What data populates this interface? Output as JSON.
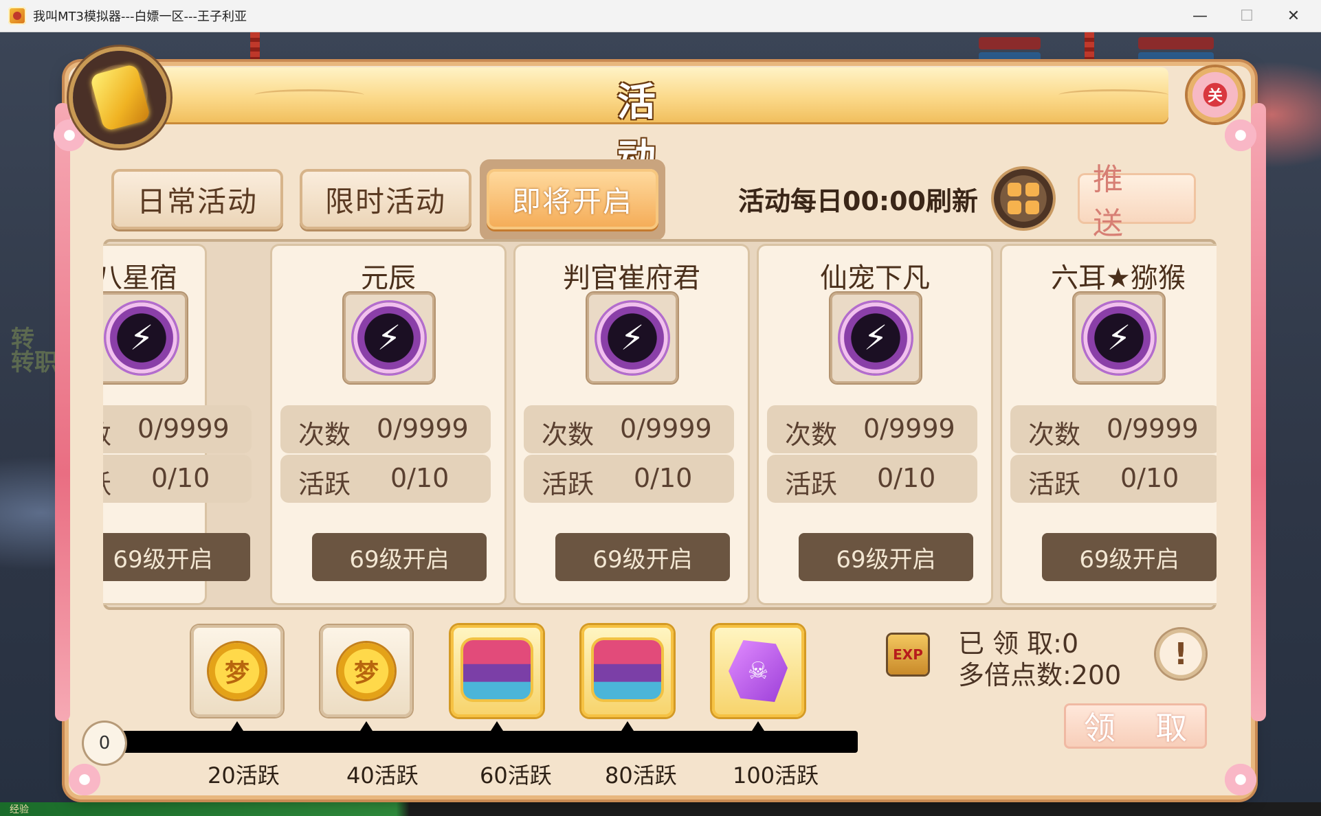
{
  "window": {
    "title": "我叫MT3模拟器---白嫖一区---王子利亚",
    "minimize_icon": "minimize-icon",
    "maximize_icon": "maximize-icon",
    "close_icon": "close-icon"
  },
  "background": {
    "side_text_1": "转",
    "side_text_2": "转职",
    "bottom_label": "经验"
  },
  "panel": {
    "title": "活 动",
    "close_label": "关",
    "tabs": [
      {
        "label": "日常活动",
        "active": false
      },
      {
        "label": "限时活动",
        "active": false
      },
      {
        "label": "即将开启",
        "active": true
      }
    ],
    "refresh_text": "活动每日00:00刷新",
    "push_label": "推 送"
  },
  "cards": [
    {
      "title": "十八星宿",
      "count_label": "次数",
      "count_value": "0/9999",
      "active_label": "活跃",
      "active_value": "0/10",
      "button": "69级开启"
    },
    {
      "title": "元辰",
      "count_label": "次数",
      "count_value": "0/9999",
      "active_label": "活跃",
      "active_value": "0/10",
      "button": "69级开启"
    },
    {
      "title": "判官崔府君",
      "count_label": "次数",
      "count_value": "0/9999",
      "active_label": "活跃",
      "active_value": "0/10",
      "button": "69级开启"
    },
    {
      "title": "仙宠下凡",
      "count_label": "次数",
      "count_value": "0/9999",
      "active_label": "活跃",
      "active_value": "0/10",
      "button": "69级开启"
    },
    {
      "title": "六耳★猕猴",
      "count_label": "次数",
      "count_value": "0/9999",
      "active_label": "活跃",
      "active_value": "0/10",
      "button": "69级开启"
    }
  ],
  "rewards": {
    "progress_value": "0",
    "progress_fraction": 0,
    "items": [
      {
        "icon": "coin-icon",
        "glyph": "梦",
        "milestone": "20活跃"
      },
      {
        "icon": "coin-icon",
        "glyph": "梦",
        "milestone": "40活跃"
      },
      {
        "icon": "treasure-chest-icon",
        "glyph": "",
        "milestone": "60活跃"
      },
      {
        "icon": "treasure-chest-icon",
        "glyph": "",
        "milestone": "80活跃"
      },
      {
        "icon": "purple-gem-icon",
        "glyph": "☠",
        "milestone": "100活跃"
      }
    ],
    "exp_icon_text": "EXP",
    "claimed_text": "已 领 取:0",
    "multiplier_text": "多倍点数:200",
    "info_label": "!",
    "claim_label": "领 取"
  }
}
